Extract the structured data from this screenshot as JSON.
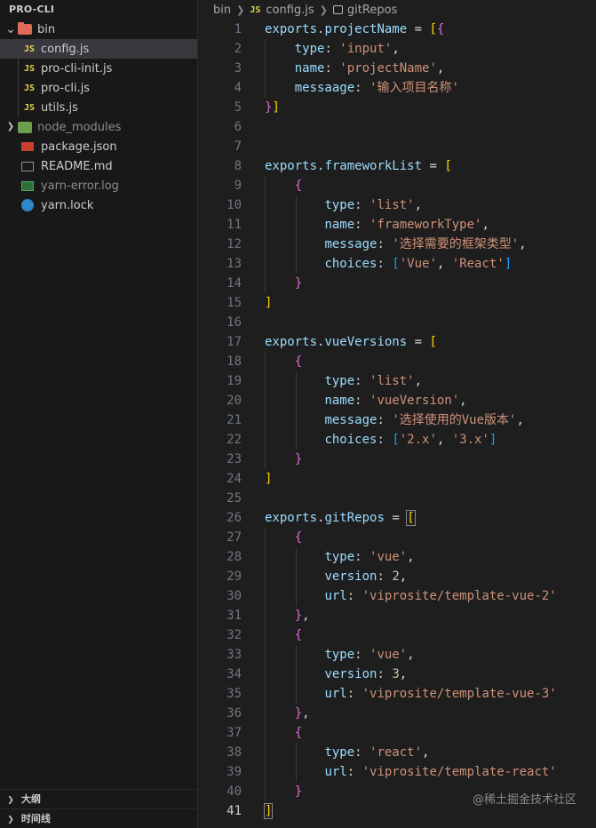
{
  "explorer": {
    "root": "PRO-CLI",
    "items": [
      {
        "label": "bin",
        "kind": "folder-bin",
        "expanded": true,
        "depth": 0
      },
      {
        "label": "config.js",
        "kind": "js",
        "depth": 1,
        "selected": true
      },
      {
        "label": "pro-cli-init.js",
        "kind": "js",
        "depth": 1
      },
      {
        "label": "pro-cli.js",
        "kind": "js",
        "depth": 1
      },
      {
        "label": "utils.js",
        "kind": "js",
        "depth": 1
      },
      {
        "label": "node_modules",
        "kind": "folder-node",
        "expanded": false,
        "depth": 0,
        "dim": true
      },
      {
        "label": "package.json",
        "kind": "npm",
        "depth": 0
      },
      {
        "label": "README.md",
        "kind": "info",
        "depth": 0
      },
      {
        "label": "yarn-error.log",
        "kind": "log",
        "depth": 0,
        "dim": true
      },
      {
        "label": "yarn.lock",
        "kind": "yarn",
        "depth": 0
      }
    ],
    "js_badge": "JS",
    "outline_label": "大纲",
    "timeline_label": "时间线"
  },
  "breadcrumb": {
    "folder": "bin",
    "file_badge": "JS",
    "file": "config.js",
    "symbol": "gitRepos"
  },
  "editor": {
    "active_line": 41,
    "lines": [
      [
        [
          "var",
          "exports"
        ],
        [
          "op",
          "."
        ],
        [
          "var",
          "projectName"
        ],
        [
          "op",
          " = "
        ],
        [
          "p1",
          "["
        ],
        [
          "p2",
          "{"
        ]
      ],
      [
        [
          "op",
          "    "
        ],
        [
          "prop",
          "type"
        ],
        [
          "op",
          ": "
        ],
        [
          "str",
          "'input'"
        ],
        [
          "op",
          ","
        ]
      ],
      [
        [
          "op",
          "    "
        ],
        [
          "prop",
          "name"
        ],
        [
          "op",
          ": "
        ],
        [
          "str",
          "'projectName'"
        ],
        [
          "op",
          ","
        ]
      ],
      [
        [
          "op",
          "    "
        ],
        [
          "prop",
          "messaage"
        ],
        [
          "op",
          ": "
        ],
        [
          "str",
          "'输入项目名称'"
        ]
      ],
      [
        [
          "p2",
          "}"
        ],
        [
          "p1",
          "]"
        ]
      ],
      [],
      [],
      [
        [
          "var",
          "exports"
        ],
        [
          "op",
          "."
        ],
        [
          "var",
          "frameworkList"
        ],
        [
          "op",
          " = "
        ],
        [
          "p1",
          "["
        ]
      ],
      [
        [
          "op",
          "    "
        ],
        [
          "p2",
          "{"
        ]
      ],
      [
        [
          "op",
          "        "
        ],
        [
          "prop",
          "type"
        ],
        [
          "op",
          ": "
        ],
        [
          "str",
          "'list'"
        ],
        [
          "op",
          ","
        ]
      ],
      [
        [
          "op",
          "        "
        ],
        [
          "prop",
          "name"
        ],
        [
          "op",
          ": "
        ],
        [
          "str",
          "'frameworkType'"
        ],
        [
          "op",
          ","
        ]
      ],
      [
        [
          "op",
          "        "
        ],
        [
          "prop",
          "message"
        ],
        [
          "op",
          ": "
        ],
        [
          "str",
          "'选择需要的框架类型'"
        ],
        [
          "op",
          ","
        ]
      ],
      [
        [
          "op",
          "        "
        ],
        [
          "prop",
          "choices"
        ],
        [
          "op",
          ": "
        ],
        [
          "p3",
          "["
        ],
        [
          "str",
          "'Vue'"
        ],
        [
          "op",
          ", "
        ],
        [
          "str",
          "'React'"
        ],
        [
          "p3",
          "]"
        ]
      ],
      [
        [
          "op",
          "    "
        ],
        [
          "p2",
          "}"
        ]
      ],
      [
        [
          "p1",
          "]"
        ]
      ],
      [],
      [
        [
          "var",
          "exports"
        ],
        [
          "op",
          "."
        ],
        [
          "var",
          "vueVersions"
        ],
        [
          "op",
          " = "
        ],
        [
          "p1",
          "["
        ]
      ],
      [
        [
          "op",
          "    "
        ],
        [
          "p2",
          "{"
        ]
      ],
      [
        [
          "op",
          "        "
        ],
        [
          "prop",
          "type"
        ],
        [
          "op",
          ": "
        ],
        [
          "str",
          "'list'"
        ],
        [
          "op",
          ","
        ]
      ],
      [
        [
          "op",
          "        "
        ],
        [
          "prop",
          "name"
        ],
        [
          "op",
          ": "
        ],
        [
          "str",
          "'vueVersion'"
        ],
        [
          "op",
          ","
        ]
      ],
      [
        [
          "op",
          "        "
        ],
        [
          "prop",
          "message"
        ],
        [
          "op",
          ": "
        ],
        [
          "str",
          "'选择使用的Vue版本'"
        ],
        [
          "op",
          ","
        ]
      ],
      [
        [
          "op",
          "        "
        ],
        [
          "prop",
          "choices"
        ],
        [
          "op",
          ": "
        ],
        [
          "p3",
          "["
        ],
        [
          "str",
          "'2.x'"
        ],
        [
          "op",
          ", "
        ],
        [
          "str",
          "'3.x'"
        ],
        [
          "p3",
          "]"
        ]
      ],
      [
        [
          "op",
          "    "
        ],
        [
          "p2",
          "}"
        ]
      ],
      [
        [
          "p1",
          "]"
        ]
      ],
      [],
      [
        [
          "var",
          "exports"
        ],
        [
          "op",
          "."
        ],
        [
          "var",
          "gitRepos"
        ],
        [
          "op",
          " = "
        ],
        [
          "p1box",
          "["
        ]
      ],
      [
        [
          "op",
          "    "
        ],
        [
          "p2",
          "{"
        ]
      ],
      [
        [
          "op",
          "        "
        ],
        [
          "prop",
          "type"
        ],
        [
          "op",
          ": "
        ],
        [
          "str",
          "'vue'"
        ],
        [
          "op",
          ","
        ]
      ],
      [
        [
          "op",
          "        "
        ],
        [
          "prop",
          "version"
        ],
        [
          "op",
          ": "
        ],
        [
          "num",
          "2"
        ],
        [
          "op",
          ","
        ]
      ],
      [
        [
          "op",
          "        "
        ],
        [
          "prop",
          "url"
        ],
        [
          "op",
          ": "
        ],
        [
          "str",
          "'viprosite/template-vue-2'"
        ]
      ],
      [
        [
          "op",
          "    "
        ],
        [
          "p2",
          "}"
        ],
        [
          "op",
          ","
        ]
      ],
      [
        [
          "op",
          "    "
        ],
        [
          "p2",
          "{"
        ]
      ],
      [
        [
          "op",
          "        "
        ],
        [
          "prop",
          "type"
        ],
        [
          "op",
          ": "
        ],
        [
          "str",
          "'vue'"
        ],
        [
          "op",
          ","
        ]
      ],
      [
        [
          "op",
          "        "
        ],
        [
          "prop",
          "version"
        ],
        [
          "op",
          ": "
        ],
        [
          "num",
          "3"
        ],
        [
          "op",
          ","
        ]
      ],
      [
        [
          "op",
          "        "
        ],
        [
          "prop",
          "url"
        ],
        [
          "op",
          ": "
        ],
        [
          "str",
          "'viprosite/template-vue-3'"
        ]
      ],
      [
        [
          "op",
          "    "
        ],
        [
          "p2",
          "}"
        ],
        [
          "op",
          ","
        ]
      ],
      [
        [
          "op",
          "    "
        ],
        [
          "p2",
          "{"
        ]
      ],
      [
        [
          "op",
          "        "
        ],
        [
          "prop",
          "type"
        ],
        [
          "op",
          ": "
        ],
        [
          "str",
          "'react'"
        ],
        [
          "op",
          ","
        ]
      ],
      [
        [
          "op",
          "        "
        ],
        [
          "prop",
          "url"
        ],
        [
          "op",
          ": "
        ],
        [
          "str",
          "'viprosite/template-react'"
        ]
      ],
      [
        [
          "op",
          "    "
        ],
        [
          "p2",
          "}"
        ]
      ],
      [
        [
          "p1box",
          "]"
        ]
      ]
    ]
  },
  "watermark": "@稀土掘金技术社区"
}
